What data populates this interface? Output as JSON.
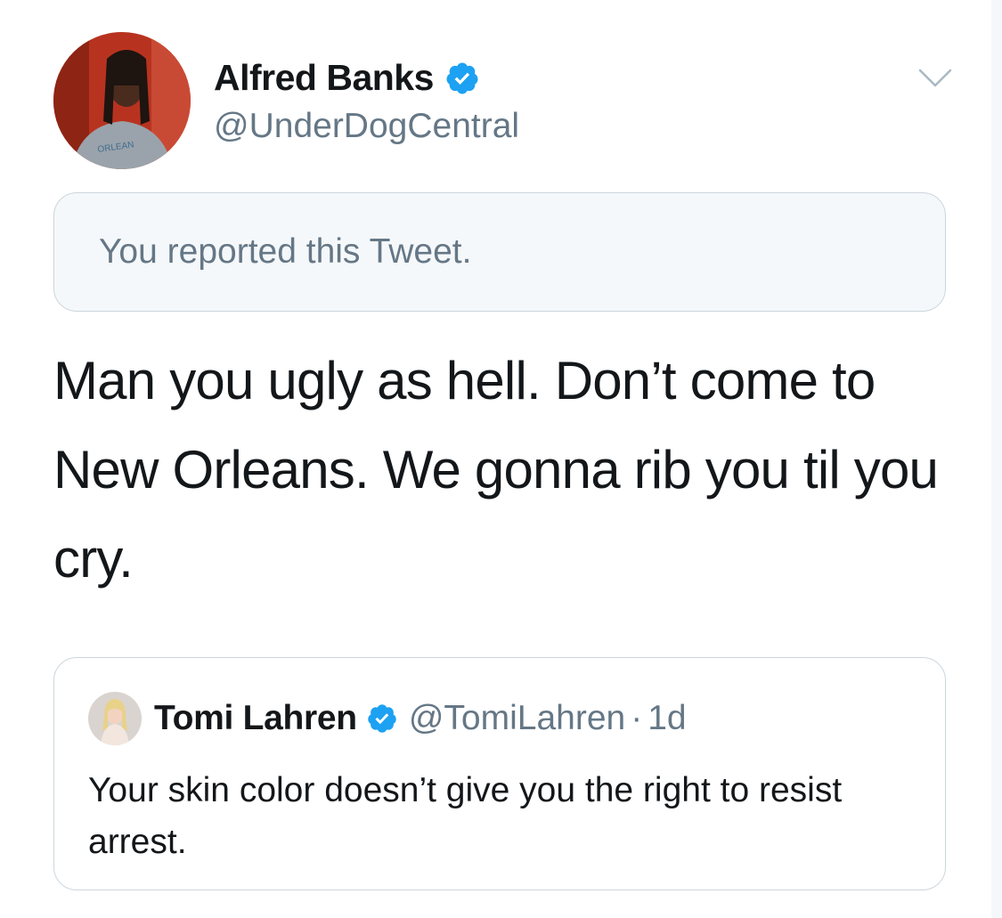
{
  "tweet": {
    "author": {
      "display_name": "Alfred Banks",
      "handle": "@UnderDogCentral",
      "verified": true
    },
    "menu_icon": "chevron-down-icon",
    "reported_notice": "You reported this Tweet.",
    "text": "Man you ugly as hell. Don’t come to New Orleans. We gonna rib you til you cry."
  },
  "quoted_tweet": {
    "author": {
      "display_name": "Tomi Lahren",
      "handle": "@TomiLahren",
      "verified": true
    },
    "separator": "·",
    "time": "1d",
    "text": "Your skin color doesn’t give you the right to resist arrest."
  },
  "colors": {
    "verified_blue": "#1da1f2",
    "secondary_text": "#657786",
    "primary_text": "#14171a",
    "border": "#ccd6dd",
    "notice_bg": "#f5f8fa"
  }
}
